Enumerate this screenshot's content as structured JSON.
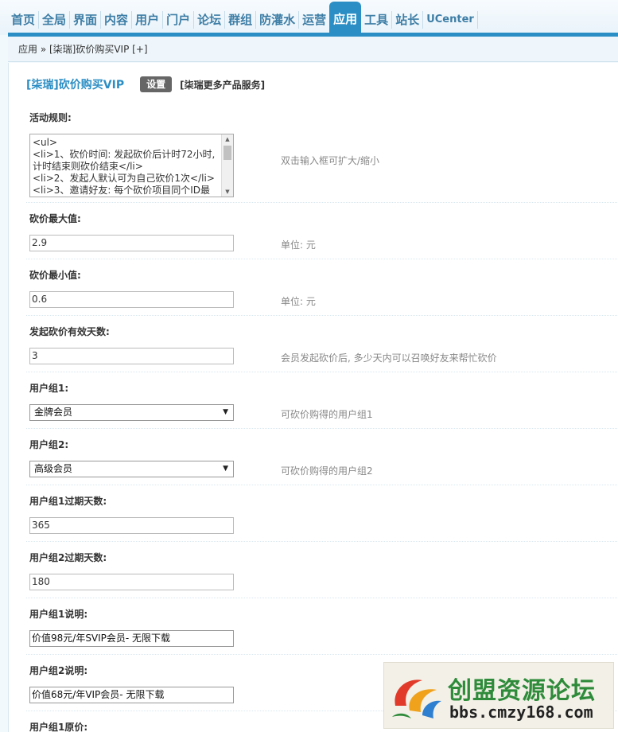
{
  "nav": {
    "items": [
      {
        "label": "首页",
        "active": false
      },
      {
        "label": "全局",
        "active": false
      },
      {
        "label": "界面",
        "active": false
      },
      {
        "label": "内容",
        "active": false
      },
      {
        "label": "用户",
        "active": false
      },
      {
        "label": "门户",
        "active": false
      },
      {
        "label": "论坛",
        "active": false
      },
      {
        "label": "群组",
        "active": false
      },
      {
        "label": "防灌水",
        "active": false
      },
      {
        "label": "运营",
        "active": false
      },
      {
        "label": "应用",
        "active": true
      },
      {
        "label": "工具",
        "active": false
      },
      {
        "label": "站长",
        "active": false
      },
      {
        "label": "UCenter",
        "active": false
      }
    ]
  },
  "breadcrumb": {
    "text": "应用 » [柒瑞]砍价购买VIP [+]"
  },
  "header": {
    "title": "[柒瑞]砍价购买VIP",
    "settings_label": "设置",
    "more_label": "[柒瑞更多产品服务]"
  },
  "rules": {
    "label": "活动规则:",
    "value": "<ul>\n<li>1、砍价时间: 发起砍价后计时72小时, 计时结束则砍价结束</li>\n<li>2、发起人默认可为自己砍价1次</li>\n<li>3、邀请好友: 每个砍价项目同个ID最",
    "tip": "双击输入框可扩大/缩小"
  },
  "fields": [
    {
      "label": "砍价最大值:",
      "value": "2.9",
      "tip": "单位: 元",
      "kind": "input"
    },
    {
      "label": "砍价最小值:",
      "value": "0.6",
      "tip": "单位: 元",
      "kind": "input"
    },
    {
      "label": "发起砍价有效天数:",
      "value": "3",
      "tip": "会员发起砍价后, 多少天内可以召唤好友来帮忙砍价",
      "kind": "input"
    },
    {
      "label": "用户组1:",
      "value": "金牌会员",
      "tip": "可砍价购得的用户组1",
      "kind": "select"
    },
    {
      "label": "用户组2:",
      "value": "高级会员",
      "tip": "可砍价购得的用户组2",
      "kind": "select"
    },
    {
      "label": "用户组1过期天数:",
      "value": "365",
      "tip": "",
      "kind": "input"
    },
    {
      "label": "用户组2过期天数:",
      "value": "180",
      "tip": "",
      "kind": "input"
    },
    {
      "label": "用户组1说明:",
      "value": "价值98元/年SVIP会员- 无限下载",
      "tip": "",
      "kind": "input-dark"
    },
    {
      "label": "用户组2说明:",
      "value": "价值68元/年VIP会员- 无限下载",
      "tip": "",
      "kind": "input-dark"
    },
    {
      "label": "用户组1原价:",
      "value": "",
      "tip": "",
      "kind": "label-only"
    }
  ],
  "watermark": {
    "name": "创盟资源论坛",
    "url": "bbs.cmzy168.com"
  },
  "colors": {
    "accent": "#2b8ec4",
    "nav_text": "#3e7ea6",
    "tip_text": "#888888"
  }
}
